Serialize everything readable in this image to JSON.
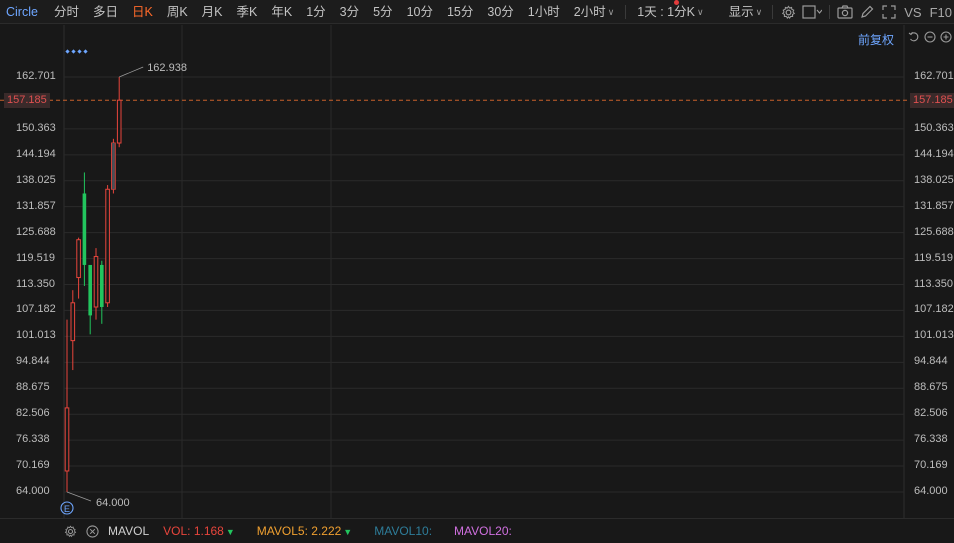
{
  "toolbar": {
    "symbol": "Circle",
    "periods": [
      {
        "label": "分时",
        "active": false
      },
      {
        "label": "多日",
        "active": false
      },
      {
        "label": "日K",
        "active": true
      },
      {
        "label": "周K",
        "active": false
      },
      {
        "label": "月K",
        "active": false
      },
      {
        "label": "季K",
        "active": false
      },
      {
        "label": "年K",
        "active": false
      },
      {
        "label": "1分",
        "active": false
      },
      {
        "label": "3分",
        "active": false
      },
      {
        "label": "5分",
        "active": false
      },
      {
        "label": "10分",
        "active": false
      },
      {
        "label": "15分",
        "active": false
      },
      {
        "label": "30分",
        "active": false
      },
      {
        "label": "1小时",
        "active": false
      },
      {
        "label": "2小时",
        "active": false,
        "dropdown": true
      }
    ],
    "custom_period": "1天 : 1分K",
    "display_label": "显示",
    "vs_label": "VS",
    "f10_label": "F10"
  },
  "chart": {
    "adjust_label": "前复权",
    "current_price": "157.185",
    "high_label": "162.938",
    "low_label": "64.000",
    "event_marker": "E",
    "colors": {
      "up": "#e8453c",
      "down": "#22c55e",
      "last": "#4a5058",
      "grid": "#2a2a2a",
      "price_line": "#c8602a",
      "accent": "#6ea6ff"
    },
    "y_ticks": [
      "162.701",
      "157.185",
      "150.363",
      "144.194",
      "138.025",
      "131.857",
      "125.688",
      "119.519",
      "113.350",
      "107.182",
      "101.013",
      "94.844",
      "88.675",
      "82.506",
      "76.338",
      "70.169",
      "64.000"
    ]
  },
  "chart_data": {
    "type": "candlestick",
    "ylim": [
      64.0,
      162.938
    ],
    "candles": [
      {
        "open": 69.0,
        "close": 84.0,
        "high": 105.0,
        "low": 64.0
      },
      {
        "open": 100.0,
        "close": 109.0,
        "high": 112.0,
        "low": 93.0
      },
      {
        "open": 115.0,
        "close": 124.0,
        "high": 124.5,
        "low": 110.0
      },
      {
        "open": 135.0,
        "close": 118.0,
        "high": 140.0,
        "low": 113.0
      },
      {
        "open": 118.0,
        "close": 106.0,
        "high": 117.0,
        "low": 101.5
      },
      {
        "open": 108.0,
        "close": 120.0,
        "high": 122.0,
        "low": 105.0
      },
      {
        "open": 118.0,
        "close": 108.0,
        "high": 119.0,
        "low": 104.0
      },
      {
        "open": 109.0,
        "close": 136.0,
        "high": 137.0,
        "low": 108.0
      },
      {
        "open": 136.0,
        "close": 147.0,
        "high": 148.0,
        "low": 135.0
      },
      {
        "open": 147.0,
        "close": 157.185,
        "high": 162.938,
        "low": 146.0
      }
    ]
  },
  "indicator": {
    "name": "MAVOL",
    "vol_label": "VOL:",
    "vol_value": "1.168",
    "mavol5_label": "MAVOL5:",
    "mavol5_value": "2.222",
    "mavol10_label": "MAVOL10:",
    "mavol20_label": "MAVOL20:",
    "colors": {
      "vol": "#e8453c",
      "mavol5": "#f0a030",
      "mavol10": "#2e7d9a",
      "mavol20": "#d070e0"
    }
  }
}
